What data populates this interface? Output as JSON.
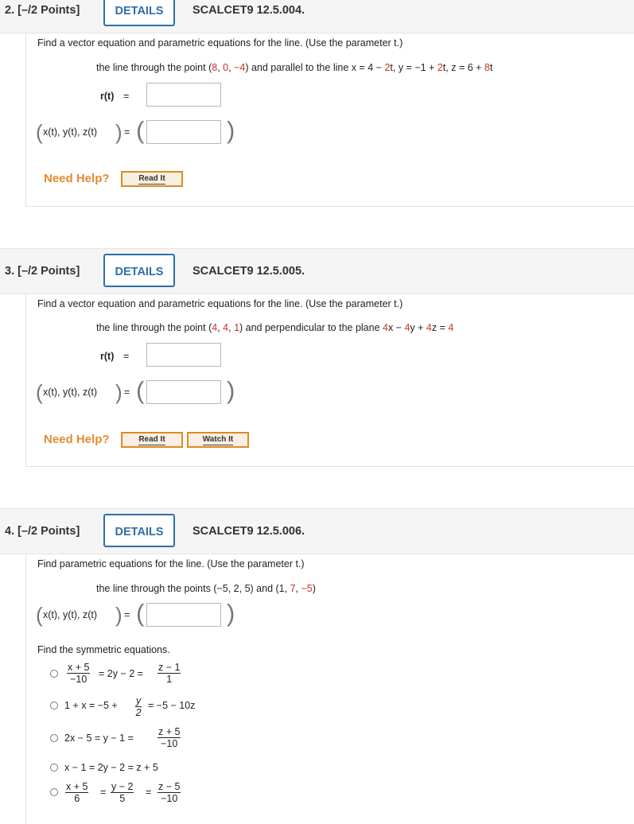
{
  "q2": {
    "number": "2.  [–/2 Points]",
    "details": "DETAILS",
    "code": "SCALCET9 12.5.004.",
    "prompt": "Find a vector equation and parametric equations for the line. (Use the parameter t.)",
    "task_parts": [
      "the line through the point (",
      "8",
      ", ",
      "0",
      ", ",
      "−4",
      ") and parallel to the line x = 4 − ",
      "2",
      "t, y = −1 + ",
      "2",
      "t, z = 6 + ",
      "8",
      "t"
    ],
    "r_label": "r(t)",
    "eq": "=",
    "xyz_label": "x(t), y(t), z(t)",
    "need_help": "Need Help?",
    "read_it": "Read It"
  },
  "q3": {
    "number": "3.  [–/2 Points]",
    "details": "DETAILS",
    "code": "SCALCET9 12.5.005.",
    "prompt": "Find a vector equation and parametric equations for the line. (Use the parameter t.)",
    "task_parts": [
      "the line through the point (",
      "4",
      ", ",
      "4",
      ", ",
      "1",
      ") and perpendicular to the plane ",
      "4",
      "x − ",
      "4",
      "y + ",
      "4",
      "z = ",
      "4"
    ],
    "r_label": "r(t)",
    "eq": "=",
    "xyz_label": "x(t), y(t), z(t)",
    "need_help": "Need Help?",
    "read_it": "Read It",
    "watch_it": "Watch It"
  },
  "q4": {
    "number": "4.  [–/2 Points]",
    "details": "DETAILS",
    "code": "SCALCET9 12.5.006.",
    "prompt": "Find parametric equations for the line. (Use the parameter t.)",
    "task_parts": [
      "the line through the points (−5, 2, 5) and (1, ",
      "7",
      ", ",
      "−5",
      ")"
    ],
    "xyz_label": "x(t), y(t), z(t)",
    "eq": "=",
    "symmetric_prompt": "Find the symmetric equations.",
    "options": [
      {
        "num1": "x + 5",
        "den1": "−10",
        "mid": "= 2y − 2 =",
        "num2": "z − 1",
        "den2": "1"
      },
      {
        "pre": "1 + x = −5 +",
        "num1": "y",
        "den1": "2",
        "post": "= −5 − 10z"
      },
      {
        "pre": "2x − 5 = y − 1 =",
        "num1": "z + 5",
        "den1": "−10"
      },
      {
        "pre": "x − 1 = 2y − 2 = z + 5"
      },
      {
        "num1": "x + 5",
        "den1": "6",
        "eq1": "=",
        "num2": "y − 2",
        "den2": "5",
        "eq2": "=",
        "num3": "z − 5",
        "den3": "−10"
      }
    ]
  }
}
